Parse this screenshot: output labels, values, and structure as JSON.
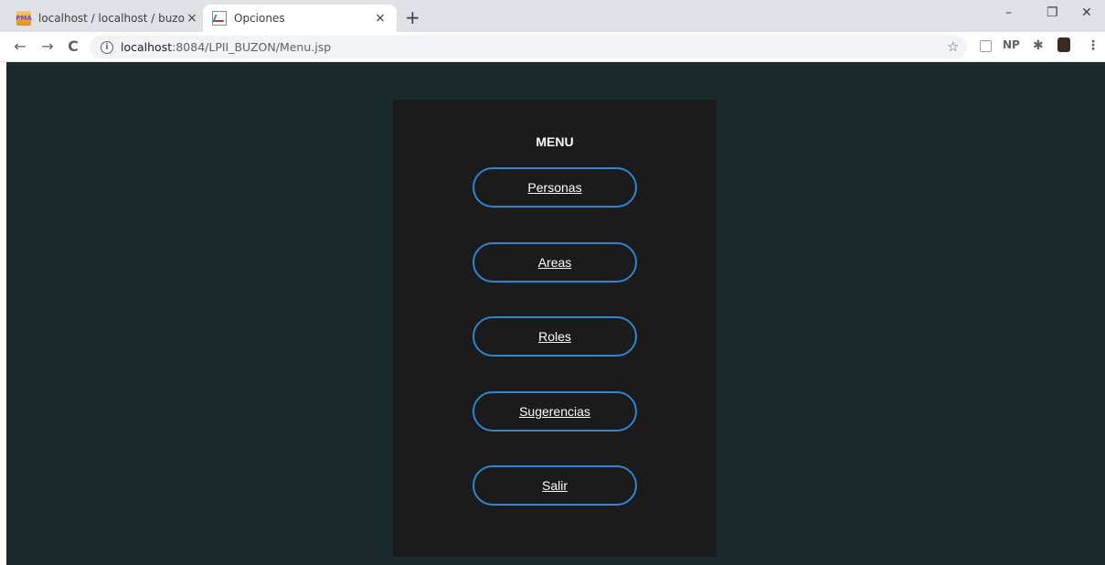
{
  "browser": {
    "tabs": [
      {
        "title": "localhost / localhost / buzon_ske",
        "icon": "phpmyadmin-icon"
      },
      {
        "title": "Opciones",
        "icon": "chart-icon"
      }
    ],
    "new_tab_label": "+",
    "close_glyph": "×",
    "window_controls": {
      "minimize": "–",
      "restore": "❐",
      "close": "✕"
    },
    "url_host": "localhost",
    "url_rest": ":8084/LPII_BUZON/Menu.jsp",
    "extensions": [
      "NP"
    ]
  },
  "colors": {
    "page_bg": "#1b2b2d",
    "panel_bg": "#1b1b1b",
    "button_border": "#2c86d2",
    "text": "#ffffff"
  },
  "menu": {
    "title": "MENU",
    "items": [
      {
        "label": "Personas"
      },
      {
        "label": "Areas"
      },
      {
        "label": "Roles"
      },
      {
        "label": "Sugerencias"
      },
      {
        "label": "Salir"
      }
    ]
  }
}
